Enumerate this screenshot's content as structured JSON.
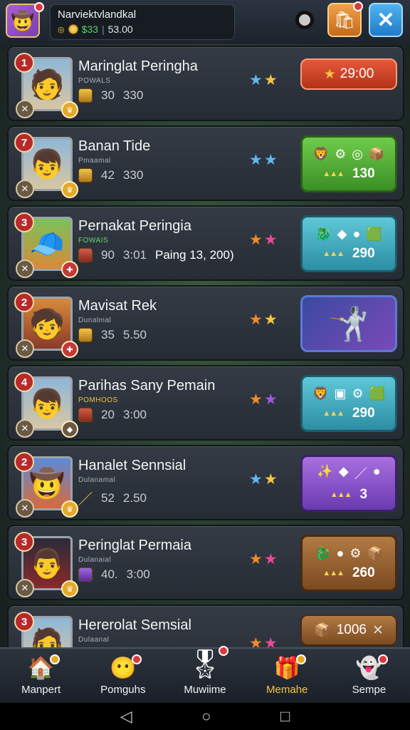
{
  "header": {
    "player_name": "Narviektvlandkal",
    "currency_green": "$33",
    "separator": "|",
    "currency_value": "53.00"
  },
  "rows": [
    {
      "rank": "1",
      "name": "Maringlat Peringha",
      "sub": "POWALS",
      "stat1": "30",
      "stat2": "330",
      "extra": "",
      "reward_type": "button",
      "reward_value": "29:00"
    },
    {
      "rank": "7",
      "name": "Banan Tide",
      "sub": "Pmaamal",
      "stat1": "42",
      "stat2": "330",
      "extra": "",
      "reward_type": "green",
      "reward_value": "130"
    },
    {
      "rank": "3",
      "name": "Pernakat Peringia",
      "sub": "FOWAIS",
      "stat1": "90",
      "stat2": "3:01",
      "extra": "Paing 13, 200)",
      "reward_type": "teal",
      "reward_value": "290"
    },
    {
      "rank": "2",
      "name": "Mavisat Rek",
      "sub": "Dunalmal",
      "stat1": "35",
      "stat2": "5.50",
      "extra": "",
      "reward_type": "art",
      "reward_value": ""
    },
    {
      "rank": "4",
      "name": "Parihas Sany Pemain",
      "sub": "POMHOOS",
      "stat1": "20",
      "stat2": "3:00",
      "extra": "",
      "reward_type": "teal",
      "reward_value": "290"
    },
    {
      "rank": "2",
      "name": "Hanalet Sennsial",
      "sub": "Dulanamal",
      "stat1": "52",
      "stat2": "2.50",
      "extra": "",
      "reward_type": "purple",
      "reward_value": "3"
    },
    {
      "rank": "3",
      "name": "Peringlat Permaia",
      "sub": "Dulanaial",
      "stat1": "40.",
      "stat2": "3:00",
      "extra": "",
      "reward_type": "brown",
      "reward_value": "260"
    },
    {
      "rank": "3",
      "name": "Hererolat Semsial",
      "sub": "Dulaanal",
      "stat1": "",
      "stat2": "",
      "extra": "",
      "reward_type": "brown-slim",
      "reward_value": "1006"
    }
  ],
  "nav": [
    {
      "label": "Manpert",
      "icon": "house-icon"
    },
    {
      "label": "Pomguhs",
      "icon": "face-icon"
    },
    {
      "label": "Muwiime",
      "icon": "star-chest-icon"
    },
    {
      "label": "Memahe",
      "icon": "gift-icon"
    },
    {
      "label": "Sempe",
      "icon": "ghost-icon"
    }
  ],
  "colors": {
    "reward_red": "#d9462a",
    "reward_green": "#57b03a",
    "reward_teal": "#3aa8bd",
    "reward_purple": "#8a52c8",
    "reward_brown": "#9a6432",
    "active_nav": "#f5c542"
  }
}
